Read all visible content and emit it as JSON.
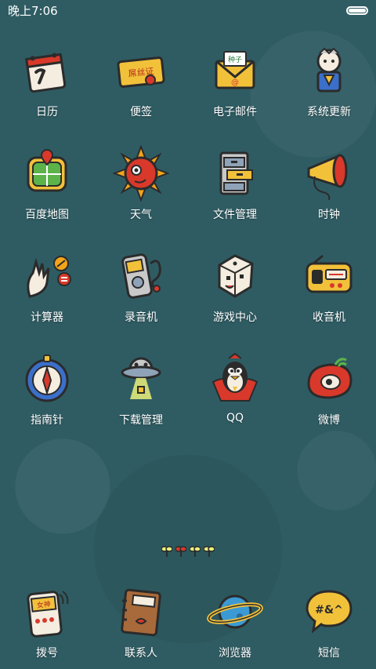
{
  "status_bar": {
    "time": "晚上7:06",
    "battery_level": 1.0
  },
  "apps": [
    {
      "label": "日历",
      "icon": "calendar-icon"
    },
    {
      "label": "便签",
      "icon": "note-scroll-icon",
      "icon_text": "屌丝证"
    },
    {
      "label": "电子邮件",
      "icon": "email-envelope-icon",
      "icon_text": "种子"
    },
    {
      "label": "系统更新",
      "icon": "superhero-update-icon"
    },
    {
      "label": "百度地图",
      "icon": "map-icon"
    },
    {
      "label": "天气",
      "icon": "sun-weather-icon"
    },
    {
      "label": "文件管理",
      "icon": "file-cabinet-icon"
    },
    {
      "label": "时钟",
      "icon": "megaphone-icon"
    },
    {
      "label": "计算器",
      "icon": "calculator-hands-icon"
    },
    {
      "label": "录音机",
      "icon": "recorder-icon"
    },
    {
      "label": "游戏中心",
      "icon": "dice-icon"
    },
    {
      "label": "收音机",
      "icon": "radio-icon"
    },
    {
      "label": "指南针",
      "icon": "compass-icon"
    },
    {
      "label": "下载管理",
      "icon": "ufo-download-icon"
    },
    {
      "label": "QQ",
      "icon": "qq-penguin-icon"
    },
    {
      "label": "微博",
      "icon": "weibo-icon"
    }
  ],
  "dock": [
    {
      "label": "拨号",
      "icon": "phone-dialer-icon",
      "icon_text": "女神"
    },
    {
      "label": "联系人",
      "icon": "contacts-book-icon"
    },
    {
      "label": "浏览器",
      "icon": "planet-browser-icon"
    },
    {
      "label": "短信",
      "icon": "message-bubble-icon",
      "icon_text": "#&^"
    }
  ]
}
